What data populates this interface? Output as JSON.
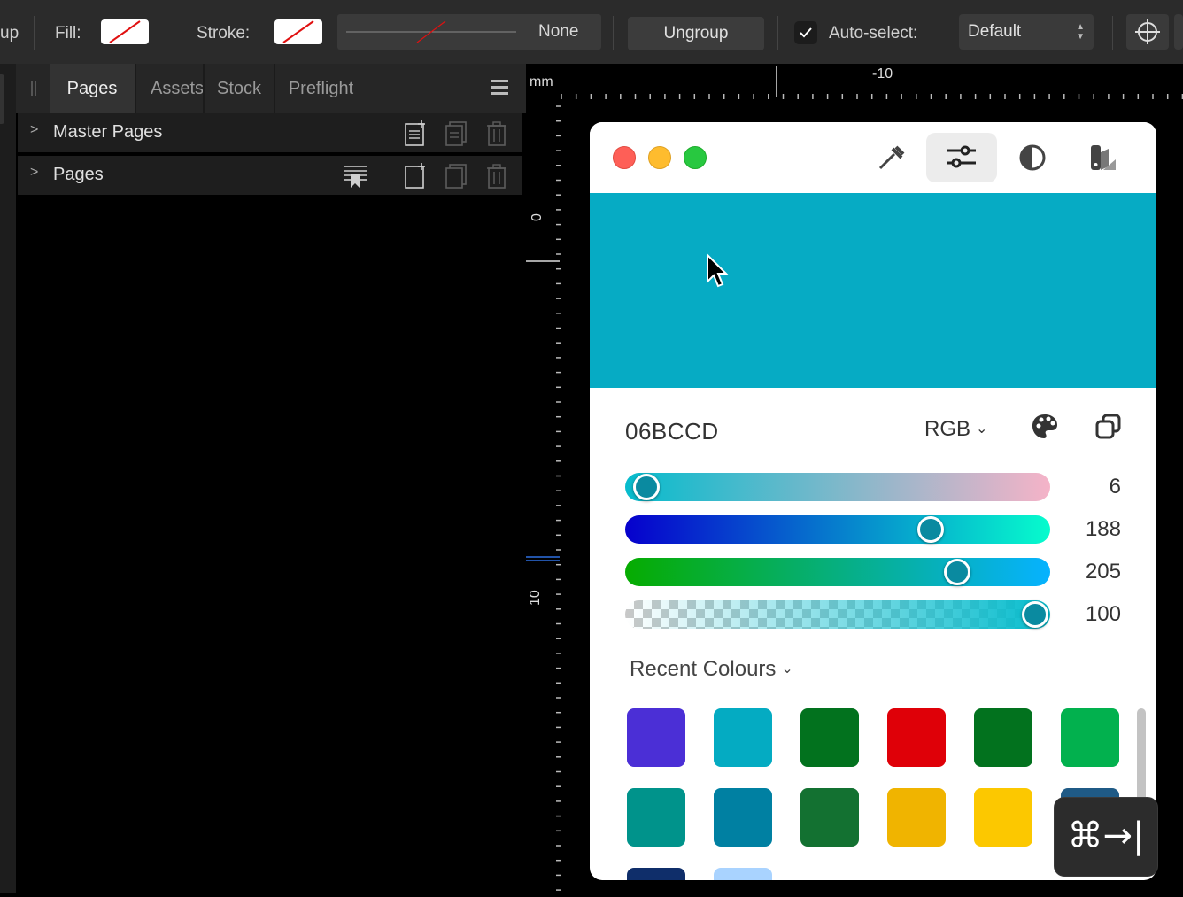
{
  "toolbar": {
    "group_fragment": "up",
    "fill_label": "Fill:",
    "stroke_label": "Stroke:",
    "stroke_style_value": "None",
    "ungroup_label": "Ungroup",
    "auto_select_label": "Auto-select:",
    "auto_select_checked": true,
    "auto_select_value": "Default"
  },
  "panel": {
    "tabs": [
      {
        "label": "Pages",
        "active": true
      },
      {
        "label": "Assets",
        "active": false
      },
      {
        "label": "Stock",
        "active": false
      },
      {
        "label": "Preflight",
        "active": false
      }
    ],
    "sections": [
      {
        "label": "Master Pages"
      },
      {
        "label": "Pages"
      }
    ]
  },
  "rulers": {
    "unit": "mm",
    "h_labels": [
      "-10"
    ],
    "v_labels": [
      "0",
      "10"
    ]
  },
  "colour_window": {
    "preview_color": "#06abc4",
    "hex_value": "06BCCD",
    "model": "RGB",
    "sliders": [
      {
        "name": "red",
        "value": "6",
        "fraction": 0.024
      },
      {
        "name": "green",
        "value": "188",
        "fraction": 0.737
      },
      {
        "name": "blue",
        "value": "205",
        "fraction": 0.804
      },
      {
        "name": "alpha",
        "value": "100",
        "fraction": 1.0
      }
    ],
    "recent_label": "Recent Colours",
    "recent_colours": [
      "#4b2fd6",
      "#04abc2",
      "#02721e",
      "#df0008",
      "#02721e",
      "#02b14e",
      "#00938b",
      "#0080a2",
      "#137131",
      "#f0b400",
      "#fcc800",
      "#1f5a86",
      "#0f2e6a",
      "#a9d3ff"
    ]
  },
  "shortcut_hud": {
    "keys": "⌘→|"
  }
}
